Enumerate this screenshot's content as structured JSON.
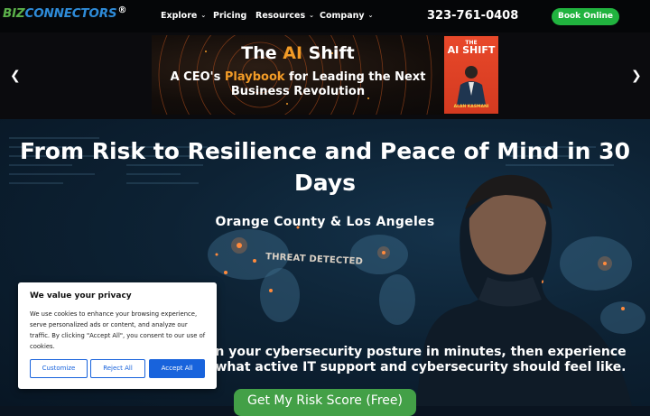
{
  "nav": {
    "logo_biz": "BIZ",
    "logo_rest": "CONNECTORS",
    "logo_mark": "®",
    "items": [
      {
        "label": "Explore",
        "has_dropdown": true
      },
      {
        "label": "Pricing",
        "has_dropdown": false
      },
      {
        "label": "Resources",
        "has_dropdown": true
      },
      {
        "label": "Company",
        "has_dropdown": true
      }
    ],
    "phone": "323-761-0408",
    "book_label": "Book Online",
    "colors": {
      "book": "#21b33f",
      "logo_green": "#5bb04a",
      "logo_blue": "#2e8bd8"
    }
  },
  "banner": {
    "title_pre": "The ",
    "title_hl": "AI",
    "title_post": " Shift",
    "line1_pre": "A CEO's ",
    "line1_hl": "Playbook",
    "line1_post": " for Leading the Next",
    "line2": "Business Revolution",
    "cover_the": "THE",
    "cover_title": "AI SHIFT",
    "cover_author": "ALAN KASMANI",
    "prev_icon": "chevron-left-icon",
    "next_icon": "chevron-right-icon",
    "colors": {
      "accent": "#f29b27",
      "cover": "#e8482a"
    }
  },
  "hero": {
    "title": "From Risk to Resilience and Peace of Mind in 30 Days",
    "location": "Orange County & Los Angeles",
    "threat_label": "THREAT DETECTED",
    "body": "n your cybersecurity posture in minutes, then experience what active IT support and cybersecurity should feel like.",
    "cta_label": "Get My Risk Score (Free)",
    "colors": {
      "cta": "#43a047"
    }
  },
  "cookie": {
    "title": "We value your privacy",
    "text": "We use cookies to enhance your browsing experience, serve personalized ads or content, and analyze our traffic. By clicking \"Accept All\", you consent to our use of cookies.",
    "customize_label": "Customize",
    "reject_label": "Reject All",
    "accept_label": "Accept All",
    "colors": {
      "primary": "#1863dc"
    }
  }
}
